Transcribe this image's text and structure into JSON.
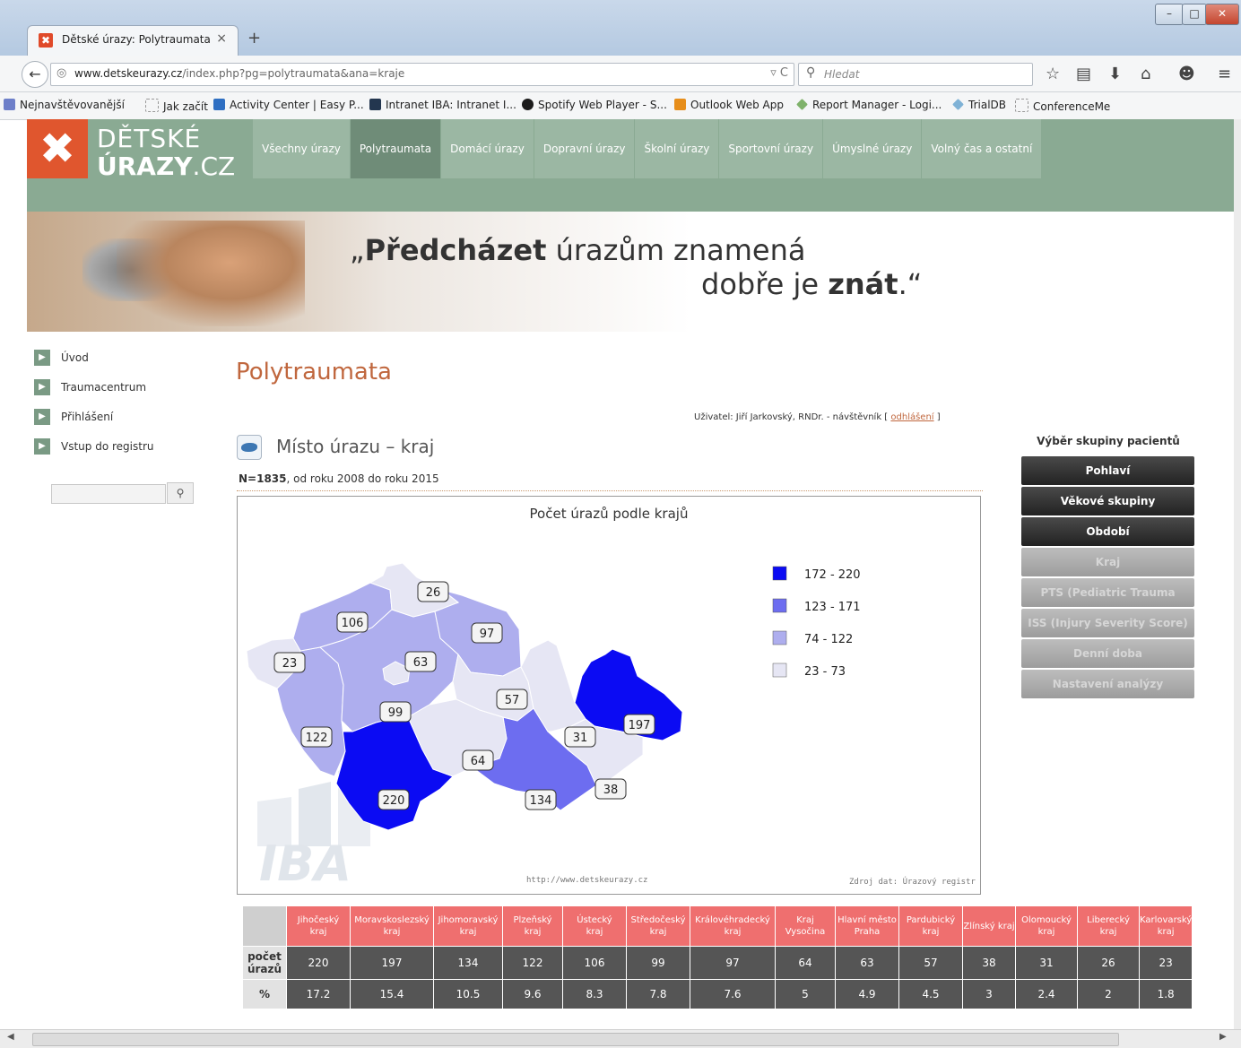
{
  "browser": {
    "tab_title": "Dětské úrazy: Polytraumata",
    "url_domain": "www.detskeurazy.cz",
    "url_path": "/index.php?pg=polytraumata&ana=kraje",
    "search_placeholder": "Hledat",
    "bookmarks": [
      "Nejnavštěvovanější",
      "Jak začít",
      "Activity Center | Easy P...",
      "Intranet IBA: Intranet I...",
      "Spotify Web Player - S...",
      "Outlook Web App",
      "Report Manager - Logi...",
      "TrialDB",
      "ConferenceMe"
    ]
  },
  "site": {
    "logo_line1": "DĚTSKÉ",
    "logo_line2_bold": "ÚRAZY",
    "logo_line2_rest": ".CZ",
    "nav": [
      "Všechny úrazy",
      "Polytraumata",
      "Domácí úrazy",
      "Dopravní úrazy",
      "Školní úrazy",
      "Sportovní úrazy",
      "Úmyslné úrazy",
      "Volný čas a ostatní"
    ],
    "nav_active": "Polytraumata",
    "slogan": {
      "q_open": "„",
      "bold1": "Předcházet",
      "rest1": " úrazům znamená",
      "pre2": "dobře je ",
      "bold2": "znát",
      "q_close": ".“"
    }
  },
  "sidebar": {
    "items": [
      "Úvod",
      "Traumacentrum",
      "Přihlášení",
      "Vstup do registru"
    ]
  },
  "content": {
    "page_title": "Polytraumata",
    "user_prefix": "Uživatel: Jiří Jarkovský, RNDr. - návštěvník [ ",
    "logout": "odhlášení",
    "user_suffix": " ]",
    "section_title": "Místo úrazu – kraj",
    "n_bold": "N=1835",
    "n_rest": ", od roku 2008 do roku 2015"
  },
  "chart_data": {
    "type": "choropleth",
    "title": "Počet úrazů podle krajů",
    "legend": [
      {
        "label": "172 - 220",
        "color": "#0b0bf3"
      },
      {
        "label": "123 - 171",
        "color": "#6d6df0"
      },
      {
        "label": "74 - 122",
        "color": "#aeaeee"
      },
      {
        "label": "23 - 73",
        "color": "#e6e6f4"
      }
    ],
    "regions": [
      {
        "name": "Jihočeský kraj",
        "value": 220
      },
      {
        "name": "Moravskoslezský kraj",
        "value": 197
      },
      {
        "name": "Jihomoravský kraj",
        "value": 134
      },
      {
        "name": "Plzeňský kraj",
        "value": 122
      },
      {
        "name": "Ústecký kraj",
        "value": 106
      },
      {
        "name": "Středočeský kraj",
        "value": 99
      },
      {
        "name": "Královéhradecký kraj",
        "value": 97
      },
      {
        "name": "Kraj Vysočina",
        "value": 64
      },
      {
        "name": "Hlavní město Praha",
        "value": 63
      },
      {
        "name": "Pardubický kraj",
        "value": 57
      },
      {
        "name": "Zlínský kraj",
        "value": 38
      },
      {
        "name": "Olomoucký kraj",
        "value": 31
      },
      {
        "name": "Liberecký kraj",
        "value": 26
      },
      {
        "name": "Karlovarský kraj",
        "value": 23
      }
    ],
    "watermark": "IBA",
    "footer_left": "http://www.detskeurazy.cz",
    "footer_right": "Zdroj dat: Úrazový registr ČR"
  },
  "right_panel": {
    "title": "Výběr skupiny pacientů",
    "buttons": [
      {
        "label": "Pohlaví",
        "enabled": true
      },
      {
        "label": "Věkové skupiny",
        "enabled": true
      },
      {
        "label": "Období",
        "enabled": true
      },
      {
        "label": "Kraj",
        "enabled": false
      },
      {
        "label": "PTS (Pediatric Trauma Score)",
        "enabled": false
      },
      {
        "label": "ISS (Injury Severity Score)",
        "enabled": false
      },
      {
        "label": "Denní doba",
        "enabled": false
      },
      {
        "label": "Nastavení analýzy",
        "enabled": false
      }
    ]
  },
  "table": {
    "headers": [
      [
        "Jihočeský",
        "kraj"
      ],
      [
        "Moravskoslezský",
        "kraj"
      ],
      [
        "Jihomoravský",
        "kraj"
      ],
      [
        "Plzeňský",
        "kraj"
      ],
      [
        "Ústecký",
        "kraj"
      ],
      [
        "Středočeský",
        "kraj"
      ],
      [
        "Královéhradecký",
        "kraj"
      ],
      [
        "Kraj",
        "Vysočina"
      ],
      [
        "Hlavní město",
        "Praha"
      ],
      [
        "Pardubický",
        "kraj"
      ],
      [
        "Zlínský kraj",
        ""
      ],
      [
        "Olomoucký",
        "kraj"
      ],
      [
        "Liberecký",
        "kraj"
      ],
      [
        "Karlovarský",
        "kraj"
      ]
    ],
    "row1_label": [
      "počet",
      "úrazů"
    ],
    "row1": [
      "220",
      "197",
      "134",
      "122",
      "106",
      "99",
      "97",
      "64",
      "63",
      "57",
      "38",
      "31",
      "26",
      "23"
    ],
    "row2_label": "%",
    "row2": [
      "17.2",
      "15.4",
      "10.5",
      "9.6",
      "8.3",
      "7.8",
      "7.6",
      "5",
      "4.9",
      "4.5",
      "3",
      "2.4",
      "2",
      "1.8"
    ]
  }
}
